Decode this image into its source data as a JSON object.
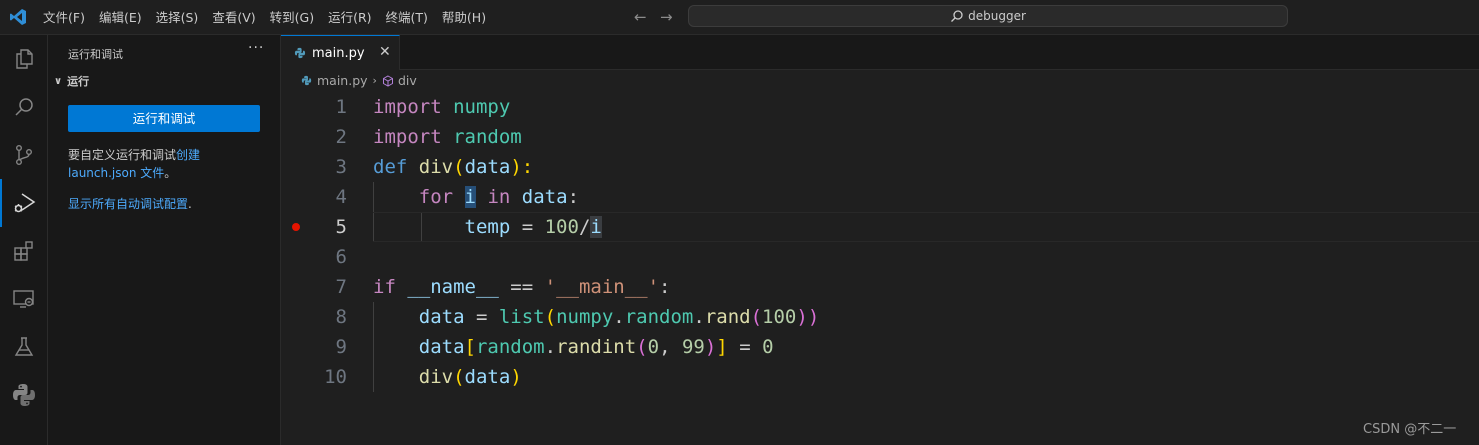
{
  "titlebar": {
    "menu": [
      "文件(F)",
      "编辑(E)",
      "选择(S)",
      "查看(V)",
      "转到(G)",
      "运行(R)",
      "终端(T)",
      "帮助(H)"
    ],
    "back_arrow": "←",
    "forward_arrow": "→",
    "search_text": "debugger"
  },
  "activitybar": {
    "icons": [
      "explorer-icon",
      "search-icon",
      "source-control-icon",
      "run-debug-icon",
      "extensions-icon",
      "remote-explorer-icon",
      "testing-icon",
      "python-icon"
    ]
  },
  "sidebar": {
    "title": "运行和调试",
    "more": "···",
    "section_chevron": "∨",
    "section": "运行",
    "run_button": "运行和调试",
    "text_prefix": "要自定义运行和调试",
    "link_create": "创建",
    "link_launch": "launch.json 文件",
    "text_suffix": "。",
    "link_auto": "显示所有自动调试配置",
    "auto_suffix": "."
  },
  "editor": {
    "tab_label": "main.py",
    "tab_close": "✕",
    "breadcrumb_file": "main.py",
    "breadcrumb_sep": "›",
    "breadcrumb_symbol": "div",
    "line_numbers": [
      "1",
      "2",
      "3",
      "4",
      "5",
      "6",
      "7",
      "8",
      "9",
      "10"
    ],
    "current_line": "5",
    "breakpoint_line": "5",
    "code": {
      "l1": [
        "import",
        " ",
        "numpy"
      ],
      "l2": [
        "import",
        " ",
        "random"
      ],
      "l3": [
        "def",
        " ",
        "div",
        "(",
        "data",
        "):"
      ],
      "l4": [
        "    ",
        "for",
        " ",
        "i",
        " ",
        "in",
        " ",
        "data",
        ":"
      ],
      "l5": [
        "        ",
        "temp",
        " = ",
        "100",
        "/",
        "i"
      ],
      "l7": [
        "if",
        " ",
        "__name__",
        " == ",
        "'__main__'",
        ":"
      ],
      "l8": [
        "    ",
        "data",
        " = ",
        "list",
        "(",
        "numpy",
        ".",
        "random",
        ".",
        "rand",
        "(",
        "100",
        "))"
      ],
      "l9": [
        "    ",
        "data",
        "[",
        "random",
        ".",
        "randint",
        "(",
        "0",
        ", ",
        "99",
        ")",
        "]",
        " = ",
        "0"
      ],
      "l10": [
        "    ",
        "div",
        "(",
        "data",
        ")"
      ]
    }
  },
  "watermark": "CSDN @不二一"
}
